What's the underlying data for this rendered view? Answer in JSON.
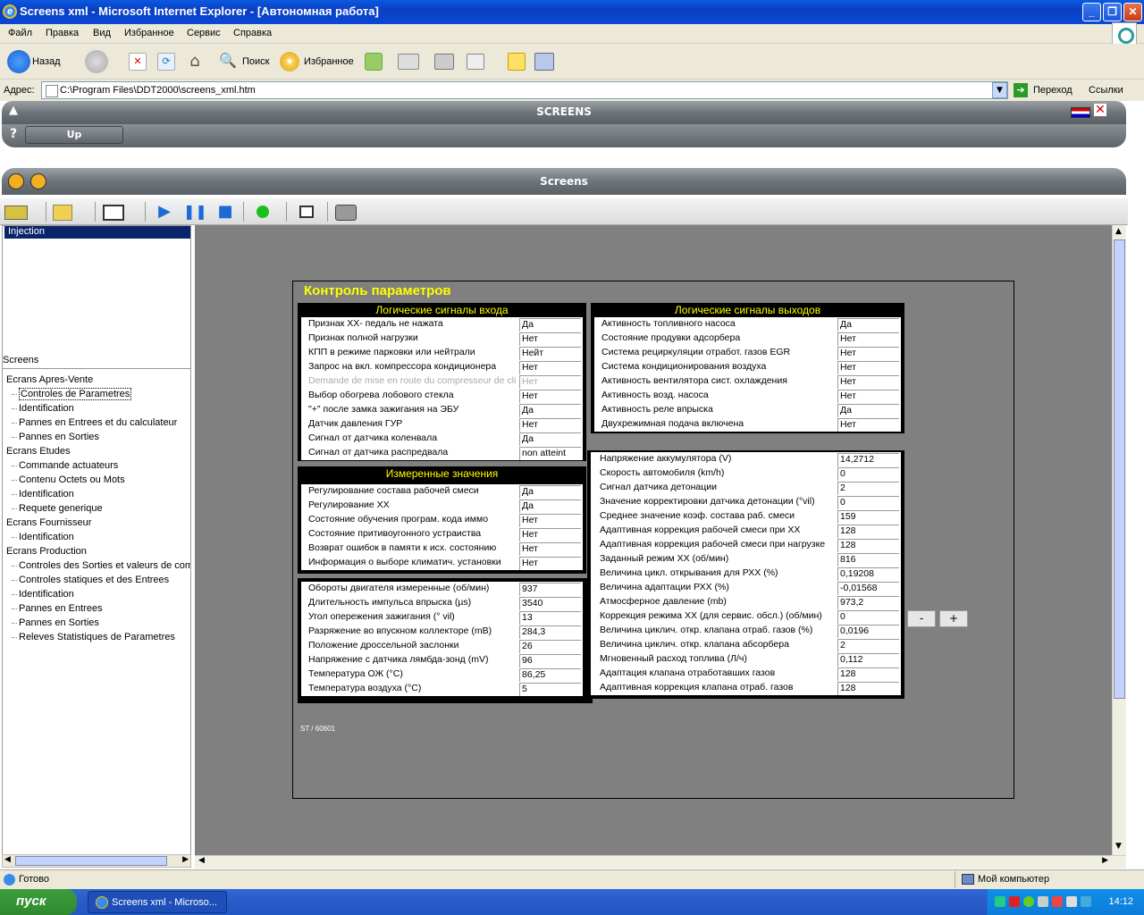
{
  "window": {
    "title": "Screens xml - Microsoft Internet Explorer - [Автономная работа]"
  },
  "menu": [
    "Файл",
    "Правка",
    "Вид",
    "Избранное",
    "Сервис",
    "Справка"
  ],
  "toolbar": {
    "back": "Назад",
    "search": "Поиск",
    "favorites": "Избранное"
  },
  "address": {
    "label": "Адрес:",
    "value": "C:\\Program Files\\DDT2000\\screens_xml.htm",
    "go": "Переход",
    "links": "Ссылки"
  },
  "app": {
    "top_title": "SCREENS",
    "help": "?",
    "up": "Up",
    "sub_title": "Screens"
  },
  "left": {
    "selected_ecu": "Injection",
    "screens_header": "Screens",
    "tree": [
      {
        "level": 0,
        "label": "Ecrans Apres-Vente"
      },
      {
        "level": 1,
        "label": "Controles de Parametres",
        "selected": true
      },
      {
        "level": 1,
        "label": "Identification"
      },
      {
        "level": 1,
        "label": "Pannes en Entrees et du calculateur"
      },
      {
        "level": 1,
        "label": "Pannes en Sorties"
      },
      {
        "level": 0,
        "label": "Ecrans Etudes"
      },
      {
        "level": 1,
        "label": "Commande actuateurs"
      },
      {
        "level": 1,
        "label": "Contenu Octets ou Mots"
      },
      {
        "level": 1,
        "label": "Identification"
      },
      {
        "level": 1,
        "label": "Requete generique"
      },
      {
        "level": 0,
        "label": "Ecrans Fournisseur"
      },
      {
        "level": 1,
        "label": "Identification"
      },
      {
        "level": 0,
        "label": "Ecrans Production"
      },
      {
        "level": 1,
        "label": "Controles des Sorties et valeurs de comm"
      },
      {
        "level": 1,
        "label": "Controles statiques et des Entrees"
      },
      {
        "level": 1,
        "label": "Identification"
      },
      {
        "level": 1,
        "label": "Pannes en Entrees"
      },
      {
        "level": 1,
        "label": "Pannes en Sorties"
      },
      {
        "level": 1,
        "label": "Releves Statistiques de Parametres"
      }
    ]
  },
  "screen": {
    "title": "Контроль параметров",
    "footer_code": "ST / 60601",
    "minus": "-",
    "plus": "+",
    "input_signals": {
      "header": "Логические сигналы входа",
      "rows": [
        {
          "label": "Признак ХХ- педаль не нажата",
          "value": "Да"
        },
        {
          "label": "Признак полной нагрузки",
          "value": "Нет"
        },
        {
          "label": "КПП в режиме парковки или нейтрали",
          "value": "Нейт"
        },
        {
          "label": "Запрос на вкл. компрессора кондиционера",
          "value": "Нет"
        },
        {
          "label": "Demande de mise en route du compresseur de cli",
          "value": "Нет",
          "dim": true
        },
        {
          "label": "Выбор обогрева лобового стекла",
          "value": "Нет"
        },
        {
          "label": "\"+\" после замка зажигания на ЭБУ",
          "value": "Да"
        },
        {
          "label": "Датчик давления ГУР",
          "value": "Нет"
        },
        {
          "label": "Сигнал от датчика коленвала",
          "value": "Да"
        },
        {
          "label": "Сигнал от датчика распредвала",
          "value": "non atteint"
        }
      ]
    },
    "output_signals": {
      "header": "Логические сигналы выходов",
      "rows": [
        {
          "label": "Активность топливного насоса",
          "value": "Да"
        },
        {
          "label": "Состояние продувки адсорбера",
          "value": "Нет"
        },
        {
          "label": "Система рециркуляции отработ. газов EGR",
          "value": "Нет"
        },
        {
          "label": "Система кондиционирования воздуха",
          "value": "Нет"
        },
        {
          "label": "Активность вентилятора сист. охлаждения",
          "value": "Нет"
        },
        {
          "label": "Активность возд. насоса",
          "value": "Нет"
        },
        {
          "label": "Активность реле впрыска",
          "value": "Да"
        },
        {
          "label": "Двухрежимная подача включена",
          "value": "Нет"
        }
      ]
    },
    "measured": {
      "header": "Измеренные значения",
      "rows": [
        {
          "label": "Регулирование состава рабочей смеси",
          "value": "Да"
        },
        {
          "label": "Регулирование ХХ",
          "value": "Да"
        },
        {
          "label": "Состояние обучения програм. кода иммо",
          "value": "Нет"
        },
        {
          "label": "Состояние притивоугонного устраиства",
          "value": "Нет"
        },
        {
          "label": "Возврат ошибок в памяти к исх. состоянию",
          "value": "Нет"
        },
        {
          "label": "Информация о выборе климатич. установки",
          "value": "Нет"
        }
      ]
    },
    "engine": {
      "rows": [
        {
          "label": "Обороты двигателя измеренные (об/мин)",
          "value": "937"
        },
        {
          "label": "Длительность импульса впрыска (µs)",
          "value": "3540"
        },
        {
          "label": "Угол опережения зажигания (° vil)",
          "value": "13"
        },
        {
          "label": "Разряжение во впускном коллекторе (mB)",
          "value": "284,3"
        },
        {
          "label": "Положение дроссельной заслонки",
          "value": "26"
        },
        {
          "label": "Напряжение с датчика лямбда-зонд (mV)",
          "value": "96"
        },
        {
          "label": "Температура ОЖ (°C)",
          "value": "86,25"
        },
        {
          "label": "Температура воздуха (°C)",
          "value": "5"
        }
      ]
    },
    "params": {
      "rows": [
        {
          "label": "Напряжение аккумулятора (V)",
          "value": "14,2712"
        },
        {
          "label": "Скорость автомобиля (km/h)",
          "value": "0"
        },
        {
          "label": "Сигнал датчика детонации",
          "value": "2"
        },
        {
          "label": "Значение корректировки датчика детонации (°vil)",
          "value": "0"
        },
        {
          "label": "Среднее значение коэф. состава раб. смеси",
          "value": "159"
        },
        {
          "label": "Адаптивная коррекция рабочей смеси при ХХ",
          "value": "128"
        },
        {
          "label": "Адаптивная коррекция рабочей смеси при нагрузке",
          "value": "128"
        },
        {
          "label": "Заданный режим ХХ (об/мин)",
          "value": "816"
        },
        {
          "label": "Величина цикл. открывания для РХХ (%)",
          "value": "0,19208"
        },
        {
          "label": "Величина адаптации РХХ (%)",
          "value": "-0,01568"
        },
        {
          "label": "Атмосферное давление (mb)",
          "value": "973,2"
        },
        {
          "label": "Коррекция режима ХХ (для сервис. обсл.) (об/мин)",
          "value": "0"
        },
        {
          "label": "Величина циклич. откр. клапана отраб. газов (%)",
          "value": "0,0196"
        },
        {
          "label": "Величина циклич. откр. клапана абсорбера",
          "value": "2"
        },
        {
          "label": "Мгновенный расход топлива (Л/ч)",
          "value": "0,112"
        },
        {
          "label": "Адаптация клапана отработавших газов",
          "value": "128"
        },
        {
          "label": "Адаптивная коррекция клапана отраб. газов",
          "value": "128"
        }
      ]
    }
  },
  "status": {
    "left": "Готово",
    "zone": "Мой компьютер"
  },
  "taskbar": {
    "start": "пуск",
    "item": "Screens xml - Microso...",
    "clock": "14:12"
  },
  "colors": {
    "accent": "#ffff00",
    "panel": "#000000",
    "workspace": "#808080",
    "selection": "#0a246a"
  }
}
